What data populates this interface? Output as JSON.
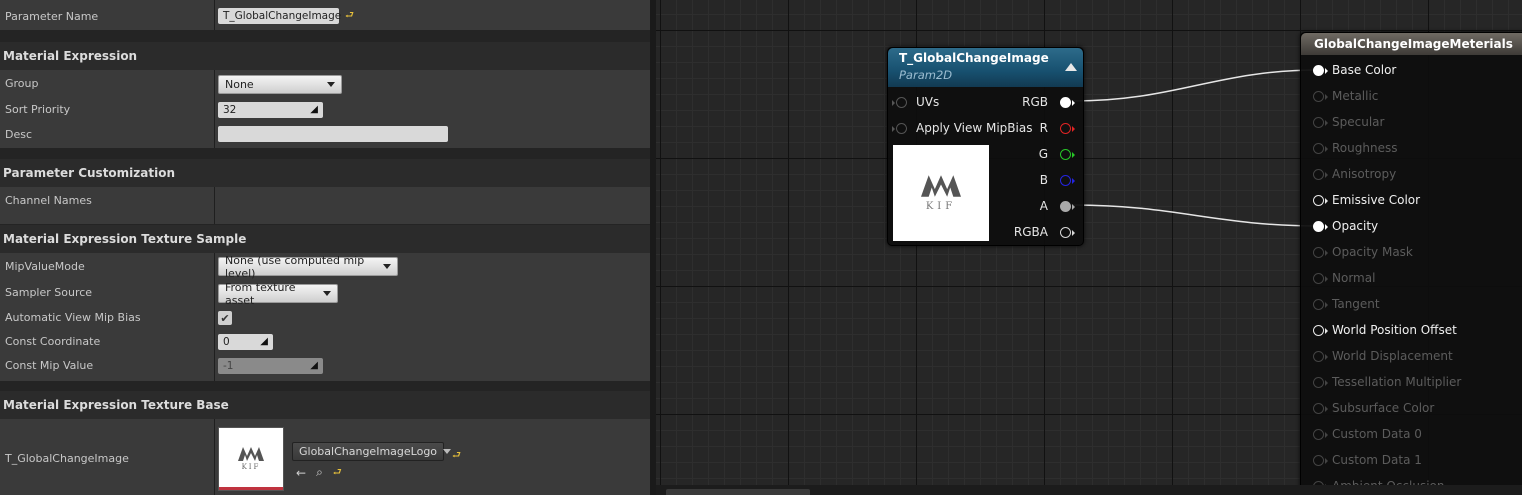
{
  "details": {
    "parameter_name": {
      "label": "Parameter Name",
      "value": "T_GlobalChangeImage"
    },
    "material_expression": {
      "title": "Material Expression",
      "group": {
        "label": "Group",
        "value": "None"
      },
      "sort_priority": {
        "label": "Sort Priority",
        "value": "32"
      },
      "desc": {
        "label": "Desc",
        "value": ""
      }
    },
    "parameter_customization": {
      "title": "Parameter Customization",
      "channel_names": {
        "label": "Channel Names"
      }
    },
    "texture_sample": {
      "title": "Material Expression Texture Sample",
      "mip_value_mode": {
        "label": "MipValueMode",
        "value": "None (use computed mip level)"
      },
      "sampler_source": {
        "label": "Sampler Source",
        "value": "From texture asset"
      },
      "auto_view_mip_bias": {
        "label": "Automatic View Mip Bias",
        "checked": true
      },
      "const_coordinate": {
        "label": "Const Coordinate",
        "value": "0"
      },
      "const_mip_value": {
        "label": "Const Mip Value",
        "value": "-1"
      }
    },
    "texture_base": {
      "title": "Material Expression Texture Base",
      "texture": {
        "label": "T_GlobalChangeImage",
        "asset": "GlobalChangeImageLogo",
        "thumb_text": "KIF"
      }
    }
  },
  "graph": {
    "texture_node": {
      "title": "T_GlobalChangeImage",
      "subtitle": "Param2D",
      "inputs": [
        "UVs",
        "Apply View MipBias"
      ],
      "outputs": [
        "RGB",
        "R",
        "G",
        "B",
        "A",
        "RGBA"
      ],
      "preview_text": "KIF"
    },
    "material_node": {
      "title": "GlobalChangeImageMeterials",
      "pins": [
        {
          "label": "Base Color",
          "active": true,
          "connected": true
        },
        {
          "label": "Metallic",
          "active": false
        },
        {
          "label": "Specular",
          "active": false
        },
        {
          "label": "Roughness",
          "active": false
        },
        {
          "label": "Anisotropy",
          "active": false
        },
        {
          "label": "Emissive Color",
          "active": true,
          "connected": false
        },
        {
          "label": "Opacity",
          "active": true,
          "connected": true
        },
        {
          "label": "Opacity Mask",
          "active": false
        },
        {
          "label": "Normal",
          "active": false
        },
        {
          "label": "Tangent",
          "active": false
        },
        {
          "label": "World Position Offset",
          "active": true,
          "connected": false
        },
        {
          "label": "World Displacement",
          "active": false
        },
        {
          "label": "Tessellation Multiplier",
          "active": false
        },
        {
          "label": "Subsurface Color",
          "active": false
        },
        {
          "label": "Custom Data 0",
          "active": false
        },
        {
          "label": "Custom Data 1",
          "active": false
        },
        {
          "label": "Ambient Occlusion",
          "active": false
        }
      ]
    },
    "colors": {
      "wire": "#e6e6e6",
      "grid_major": "#111111",
      "grid_minor": "#2e2e2e",
      "texture_header": "#17506f",
      "material_header": "#5a5650"
    }
  }
}
